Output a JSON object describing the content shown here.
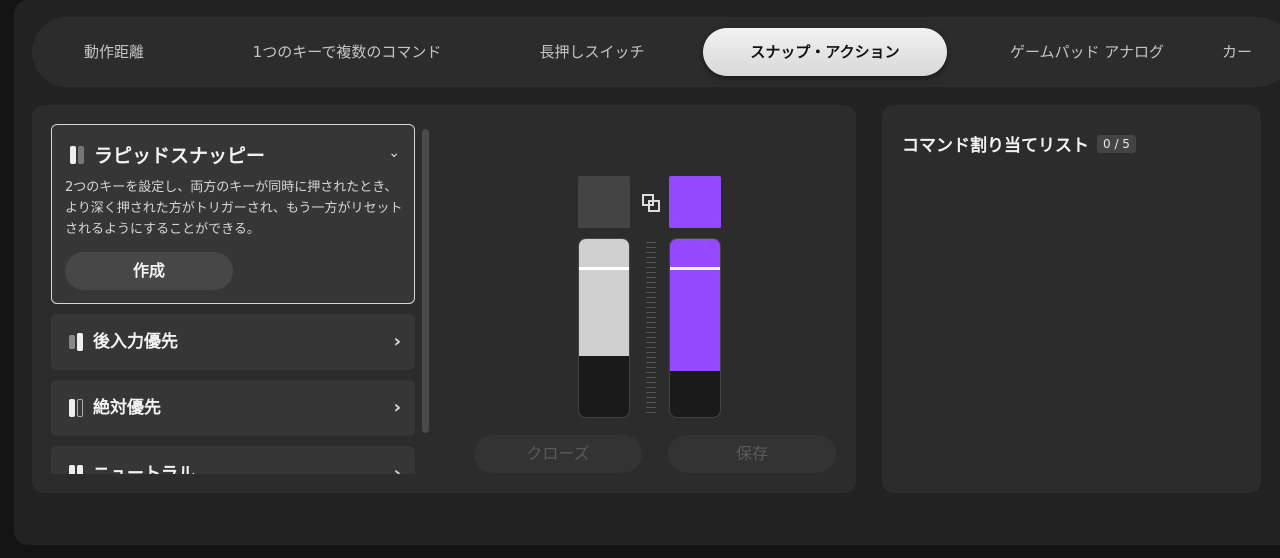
{
  "tabs": [
    {
      "label": "動作距離",
      "active": false
    },
    {
      "label": "1つのキーで複数のコマンド",
      "active": false
    },
    {
      "label": "長押しスイッチ",
      "active": false
    },
    {
      "label": "スナップ・アクション",
      "active": true
    },
    {
      "label": "ゲームパッド アナログ",
      "active": false
    },
    {
      "label": "カー",
      "active": false
    }
  ],
  "modes": {
    "rapid": {
      "title": "ラピッドスナッピー",
      "description": "2つのキーを設定し、両方のキーが同時に押されたとき、より深く押された方がトリガーされ、もう一方がリセットされるようにすることができる。",
      "create_label": "作成"
    },
    "items": [
      {
        "label": "後入力優先"
      },
      {
        "label": "絶対優先"
      },
      {
        "label": "ニュートラル"
      }
    ]
  },
  "visualizer": {
    "key_a_color": "#444444",
    "key_b_color": "#9448ff",
    "key_a_fill": 0.66,
    "key_b_fill": 0.74,
    "trigger_level": 0.16,
    "close_label": "クローズ",
    "save_label": "保存"
  },
  "assignment": {
    "title": "コマンド割り当てリスト",
    "count": "0 / 5"
  },
  "colors": {
    "accent": "#9448ff",
    "light_fill": "#cfcfcf"
  }
}
